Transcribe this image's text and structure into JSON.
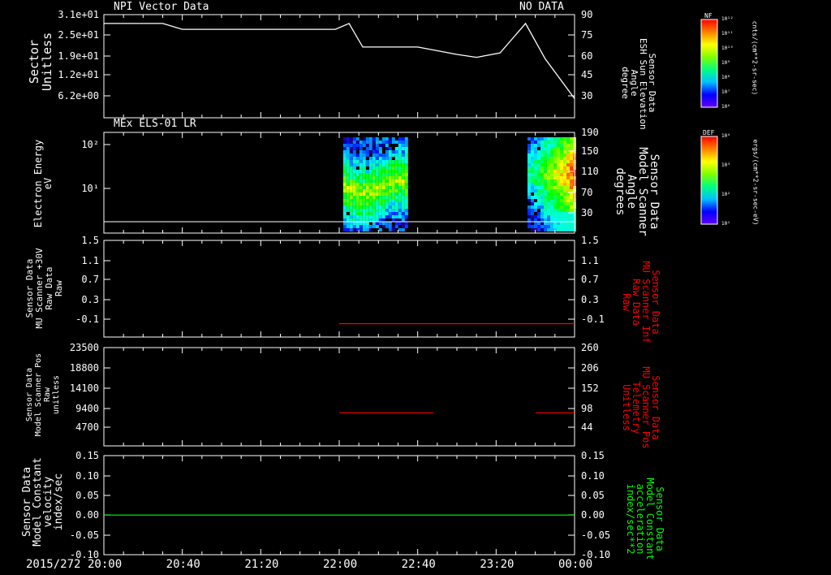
{
  "colors": {
    "red": "#ff0000",
    "green": "#00ff00",
    "white": "#ffffff"
  },
  "panel1": {
    "title_left": "NPI Vector Data",
    "title_right": "NO DATA",
    "left_label": [
      "Sector",
      "Unitless"
    ],
    "left_ticks": [
      "3.1e+01",
      "2.5e+01",
      "1.9e+01",
      "1.2e+01",
      "6.2e+00"
    ],
    "right_label": [
      "Sensor Data",
      "ESH Sun Elevation",
      "Angle",
      "degree"
    ],
    "right_ticks": [
      "90",
      "75",
      "60",
      "45",
      "30"
    ]
  },
  "panel2": {
    "title": "MEx ELS-01 LR",
    "left_label": [
      "Electron Energy",
      "eV"
    ],
    "left_ticks": [
      "10²",
      "10¹"
    ],
    "right_label": [
      "Sensor Data",
      "Model Scanner",
      "Angle",
      "degrees"
    ],
    "right_ticks": [
      "190",
      "150",
      "110",
      "70",
      "30"
    ]
  },
  "panel3": {
    "left_label": [
      "Sensor Data",
      "MU Scanner +30V",
      "Raw Data",
      "Raw"
    ],
    "left_ticks": [
      "1.5",
      "1.1",
      "0.7",
      "0.3",
      "-0.1"
    ],
    "right_label": [
      "Sensor Data",
      "MU Scanner Inf",
      "Raw Data",
      "Raw"
    ],
    "right_ticks": [
      "1.5",
      "1.1",
      "0.7",
      "0.3",
      "-0.1"
    ]
  },
  "panel4": {
    "left_label": [
      "Sensor Data",
      "Model Scanner Pos",
      "Raw",
      "unitless"
    ],
    "left_ticks": [
      "23500",
      "18800",
      "14100",
      "9400",
      "4700"
    ],
    "right_label": [
      "Sensor Data",
      "MU Scanner Pos",
      "Telemetry",
      "Unitless"
    ],
    "right_ticks": [
      "260",
      "206",
      "152",
      "98",
      "44"
    ]
  },
  "panel5": {
    "left_label": [
      "Sensor Data",
      "Model Constant",
      "velocity",
      "index/sec"
    ],
    "left_ticks": [
      "0.15",
      "0.10",
      "0.05",
      "0.00",
      "-0.05",
      "-0.10"
    ],
    "right_label": [
      "Sensor Data",
      "Model Constant",
      "acceleration",
      "index/sec**2"
    ],
    "right_ticks": [
      "0.15",
      "0.10",
      "0.05",
      "0.00",
      "-0.05",
      "-0.10"
    ]
  },
  "xaxis": {
    "date": "2015/272",
    "ticks": [
      "20:00",
      "20:40",
      "21:20",
      "22:00",
      "22:40",
      "23:20",
      "00:00"
    ]
  },
  "colorbar1": {
    "tag": "NF",
    "ticks": [
      "10¹²",
      "10¹¹",
      "10¹⁰",
      "10⁹",
      "10⁸",
      "10⁷",
      "10⁶"
    ],
    "unit": "cnts/(cm**2-sr-sec)"
  },
  "colorbar2": {
    "tag": "DEF",
    "ticks": [
      "10⁴",
      "10³",
      "10²",
      "10¹"
    ],
    "unit": "ergs/(cm**2-sr-sec-eV)"
  },
  "chart_data": [
    {
      "type": "line",
      "title": "NPI Vector Data",
      "xlabel": "",
      "ylabel": "Sensor Data ESH Sun Elevation Angle degree",
      "ylim": [
        20,
        90
      ],
      "x": [
        "20:00",
        "20:30",
        "20:40",
        "21:20",
        "21:58",
        "22:05",
        "22:12",
        "22:40",
        "23:00",
        "23:10",
        "23:22",
        "23:35",
        "23:45",
        "00:00"
      ],
      "series": [
        {
          "values": [
            84,
            84,
            80,
            80,
            80,
            84,
            68,
            68,
            63,
            61,
            64,
            84,
            60,
            33
          ]
        }
      ]
    },
    {
      "type": "heatmap",
      "title": "MEx ELS-01 LR",
      "ylabel": "Electron Energy eV",
      "scale": "log",
      "x_intervals": [
        [
          "22:02",
          "22:34"
        ],
        [
          "23:36",
          "00:00"
        ]
      ]
    },
    {
      "type": "line",
      "ylabel": "Sensor Data MU Scanner +30V Raw Data Raw",
      "ylim": [
        -0.3,
        1.5
      ],
      "series": [
        {
          "color": "#ff0000",
          "x": [
            "22:00",
            "00:00"
          ],
          "values": [
            -0.05,
            -0.05
          ]
        }
      ]
    },
    {
      "type": "line",
      "ylabel": "Sensor Data Model Scanner Pos Raw unitless",
      "ylim": [
        0,
        23500
      ],
      "series": [
        {
          "color": "#ff0000",
          "x": [
            "22:00",
            "22:48"
          ],
          "values": [
            7900,
            7900
          ]
        },
        {
          "color": "#ff0000",
          "x": [
            "23:40",
            "00:00"
          ],
          "values": [
            7900,
            7900
          ]
        }
      ]
    },
    {
      "type": "line",
      "ylabel": "Sensor Data Model Constant velocity index/sec",
      "ylim": [
        -0.1,
        0.15
      ],
      "series": [
        {
          "color": "#00ff00",
          "x": [
            "20:00",
            "00:00"
          ],
          "values": [
            0.0,
            0.0
          ]
        }
      ]
    }
  ]
}
